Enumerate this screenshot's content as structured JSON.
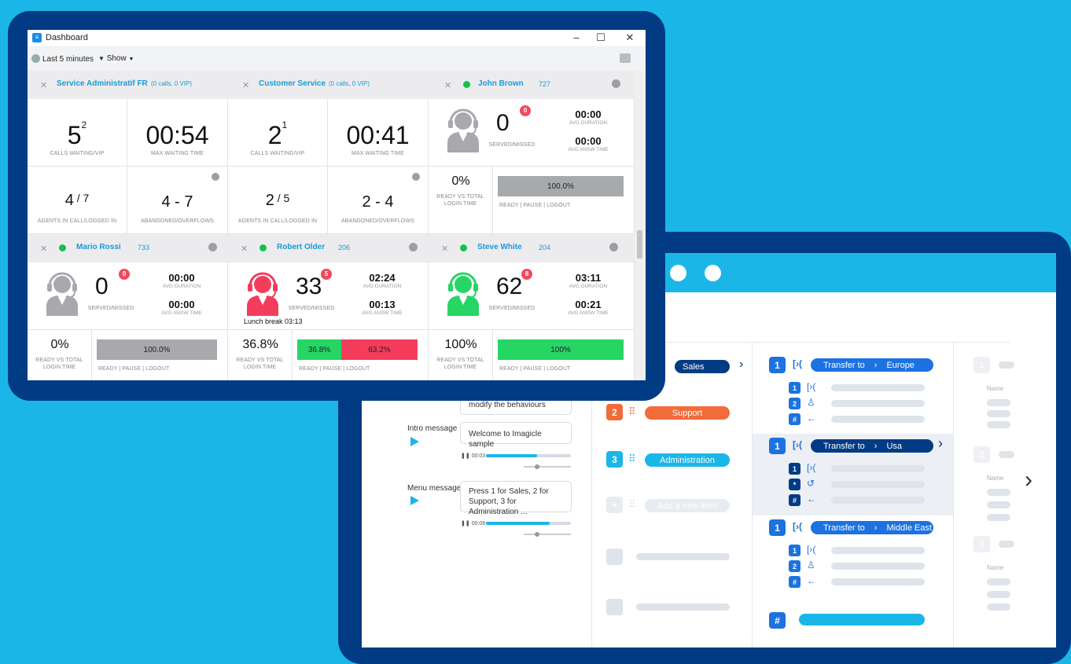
{
  "dashboard": {
    "window_title": "Dashboard",
    "toolbar": {
      "time_range": "Last 5 minutes",
      "show": "Show"
    },
    "queues": [
      {
        "name": "Service Administratif FR",
        "sub": "(0 calls, 0 VIP)",
        "calls_waiting": "5",
        "vip": "2",
        "max_wait": "00:54",
        "agents_in_call": "4",
        "logged_in": "7",
        "abandoned_overflows": "4 - 7"
      },
      {
        "name": "Customer Service",
        "sub": "(0 calls, 0 VIP)",
        "calls_waiting": "2",
        "vip": "1",
        "max_wait": "00:41",
        "agents_in_call": "2",
        "logged_in": "5",
        "abandoned_overflows": "2 - 4"
      }
    ],
    "labels": {
      "calls_waiting": "CALLS WAITING/VIP",
      "max_wait": "MAX WAITING TIME",
      "agents": "AGENTS IN CALL/LOGGED IN",
      "abandoned": "ABANDONED/OVERFLOWS",
      "served": "SERVED/MISSED",
      "avg_duration": "AVG DURATION",
      "avg_answ": "AVG ANSW TIME",
      "ready_vs_total": "READY VS TOTAL",
      "login_time": "LOGIN TIME",
      "ready_pause_logout": "READY | PAUSE | LOGOUT"
    },
    "agents": [
      {
        "name": "John Brown",
        "ext": "727",
        "served": "0",
        "missed": "0",
        "avg_duration": "00:00",
        "avg_answ": "00:00",
        "ready_pct": "0%",
        "bars": [
          {
            "label": "100.0%",
            "color": "#a7a9ac",
            "frac": 1.0
          }
        ],
        "status_color": "#a7a9ac",
        "note": ""
      },
      {
        "name": "Mario Rossi",
        "ext": "733",
        "served": "0",
        "missed": "0",
        "avg_duration": "00:00",
        "avg_answ": "00:00",
        "ready_pct": "0%",
        "bars": [
          {
            "label": "100.0%",
            "color": "#a7a9ac",
            "frac": 1.0
          }
        ],
        "status_color": "#a7a9ac",
        "note": ""
      },
      {
        "name": "Robert Older",
        "ext": "206",
        "served": "33",
        "missed": "5",
        "avg_duration": "02:24",
        "avg_answ": "00:13",
        "ready_pct": "36.8%",
        "bars": [
          {
            "label": "36.8%",
            "color": "#27d565",
            "frac": 0.368
          },
          {
            "label": "63,2%",
            "color": "#f43d5d",
            "frac": 0.632
          }
        ],
        "status_color": "#f43d5d",
        "note": "Lunch break 03:13"
      },
      {
        "name": "Steve White",
        "ext": "204",
        "served": "62",
        "missed": "8",
        "avg_duration": "03:11",
        "avg_answ": "00:21",
        "ready_pct": "100%",
        "bars": [
          {
            "label": "100%",
            "color": "#27d565",
            "frac": 1.0
          }
        ],
        "status_color": "#27d565",
        "note": ""
      }
    ]
  },
  "ivr": {
    "messages": [
      {
        "label": "",
        "text": "modify the behaviours",
        "time": ""
      },
      {
        "label": "Intro message",
        "text": "Welcome to Imagicle sample",
        "time": "00:03",
        "progress": 0.6
      },
      {
        "label": "Menu message",
        "text": "Press 1 for Sales, 2 for Support, 3 for Administration ...",
        "time": "00:08",
        "progress": 0.75
      }
    ],
    "menu_items": [
      {
        "num": "",
        "label": "Sales",
        "color": "#003b83"
      },
      {
        "num": "2",
        "label": "Support",
        "color": "#f26b3a"
      },
      {
        "num": "3",
        "label": "Administration",
        "color": "#1bb6e8"
      },
      {
        "num": "+",
        "label": "Add a new item",
        "color": "#dfe3ea"
      }
    ],
    "transfers": [
      {
        "num": "1",
        "action": "Transfer to",
        "dest": "Europe"
      },
      {
        "num": "1",
        "action": "Transfer to",
        "dest": "Usa"
      },
      {
        "num": "1",
        "action": "Transfer to",
        "dest": "Middle East"
      }
    ],
    "hash": "#",
    "name_label": "Name",
    "right_nums": [
      "1",
      "2",
      "3"
    ],
    "sub_keys": [
      [
        "1",
        "2",
        "#"
      ],
      [
        "1",
        "*",
        "#"
      ],
      [
        "1",
        "2",
        "#"
      ]
    ]
  }
}
